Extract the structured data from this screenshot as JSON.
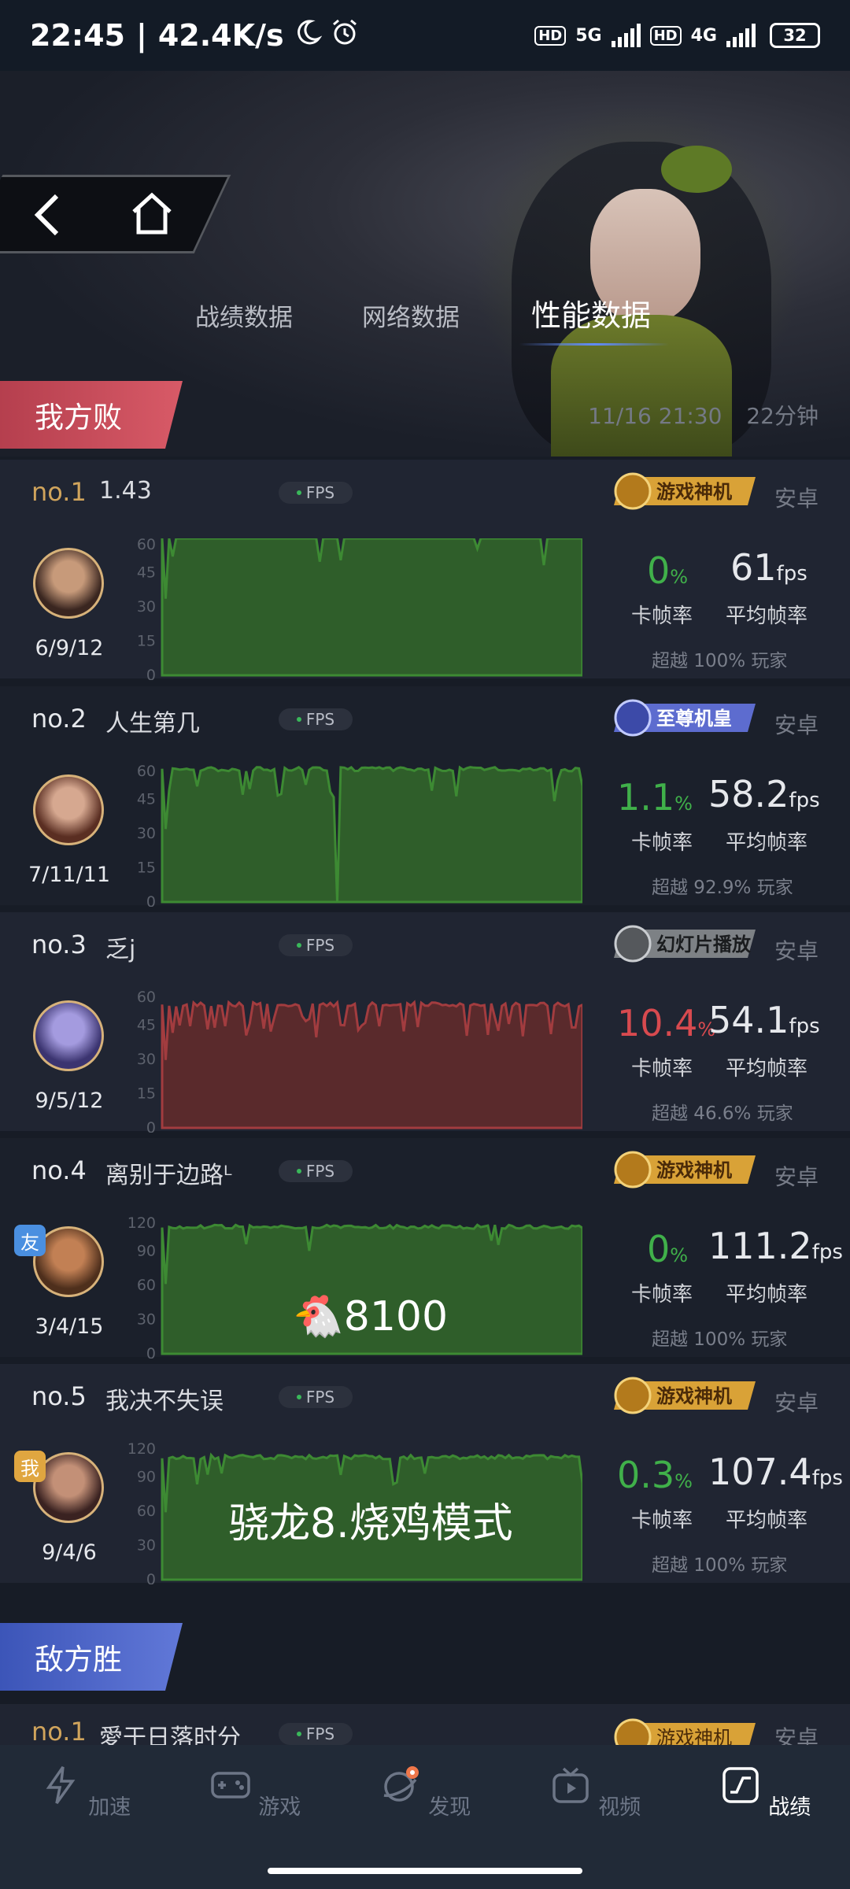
{
  "status_bar": {
    "time": "22:45",
    "speed": "42.4K/s",
    "net1": "5G",
    "net2": "4G",
    "battery": "32",
    "hd": "HD"
  },
  "header": {
    "tabs": [
      {
        "label": "战绩数据",
        "active": false
      },
      {
        "label": "网络数据",
        "active": false
      },
      {
        "label": "性能数据",
        "active": true
      }
    ]
  },
  "my_team": {
    "result": "我方败",
    "date_time": "11/16 21:30",
    "duration": "22分钟"
  },
  "enemy_team": {
    "result": "敌方胜"
  },
  "fps_tag": "FPS",
  "labels": {
    "stutter": "卡帧率",
    "avg_fps": "平均帧率",
    "fps_unit": "fps",
    "pct": "%"
  },
  "players": [
    {
      "rank": "no.1",
      "name": "1.43",
      "badge": "游戏神机",
      "os": "安卓",
      "kda": "6/9/12",
      "stutter": "0",
      "avg": "61",
      "beat": "超越 100% 玩家",
      "ymax": 60,
      "ticks": [
        0,
        15,
        30,
        45,
        60
      ],
      "color": "#2f5e2a",
      "line": "#3d8a33"
    },
    {
      "rank": "no.2",
      "name": "人生第几",
      "badge": "至尊机皇",
      "os": "安卓",
      "kda": "7/11/11",
      "stutter": "1.1",
      "avg": "58.2",
      "beat": "超越 92.9% 玩家",
      "ymax": 60,
      "ticks": [
        0,
        15,
        30,
        45,
        60
      ],
      "color": "#2f5e2a",
      "line": "#3d8a33"
    },
    {
      "rank": "no.3",
      "name": "乏j",
      "badge": "幻灯片播放",
      "os": "安卓",
      "kda": "9/5/12",
      "stutter": "10.4",
      "avg": "54.1",
      "beat": "超越 46.6% 玩家",
      "ymax": 60,
      "ticks": [
        0,
        15,
        30,
        45,
        60
      ],
      "color": "#5a2a2c",
      "line": "#a23c3f"
    },
    {
      "rank": "no.4",
      "name": "离别于边路ᴸ",
      "badge": "游戏神机",
      "os": "安卓",
      "kda": "3/4/15",
      "tag": "友",
      "stutter": "0",
      "avg": "111.2",
      "beat": "超越 100% 玩家",
      "ymax": 120,
      "ticks": [
        0,
        30,
        60,
        90,
        120
      ],
      "color": "#2f5e2a",
      "line": "#3d8a33",
      "overlay": "🐔8100"
    },
    {
      "rank": "no.5",
      "name": "我决不失误",
      "badge": "游戏神机",
      "os": "安卓",
      "kda": "9/4/6",
      "tag": "我",
      "stutter": "0.3",
      "avg": "107.4",
      "beat": "超越 100% 玩家",
      "ymax": 120,
      "ticks": [
        0,
        30,
        60,
        90,
        120
      ],
      "color": "#2f5e2a",
      "line": "#3d8a33",
      "overlay": "骁龙8.烧鸡模式"
    }
  ],
  "enemy_first": {
    "rank": "no.1",
    "name": "愛于日落时分",
    "badge": "游戏神机",
    "os": "安卓"
  },
  "bottom_nav": [
    {
      "label": "加速",
      "icon": "lightning-icon",
      "active": false
    },
    {
      "label": "游戏",
      "icon": "gamepad-icon",
      "active": false
    },
    {
      "label": "发现",
      "icon": "planet-icon",
      "active": false
    },
    {
      "label": "视频",
      "icon": "tv-icon",
      "active": false
    },
    {
      "label": "战绩",
      "icon": "stats-icon",
      "active": true
    }
  ]
}
